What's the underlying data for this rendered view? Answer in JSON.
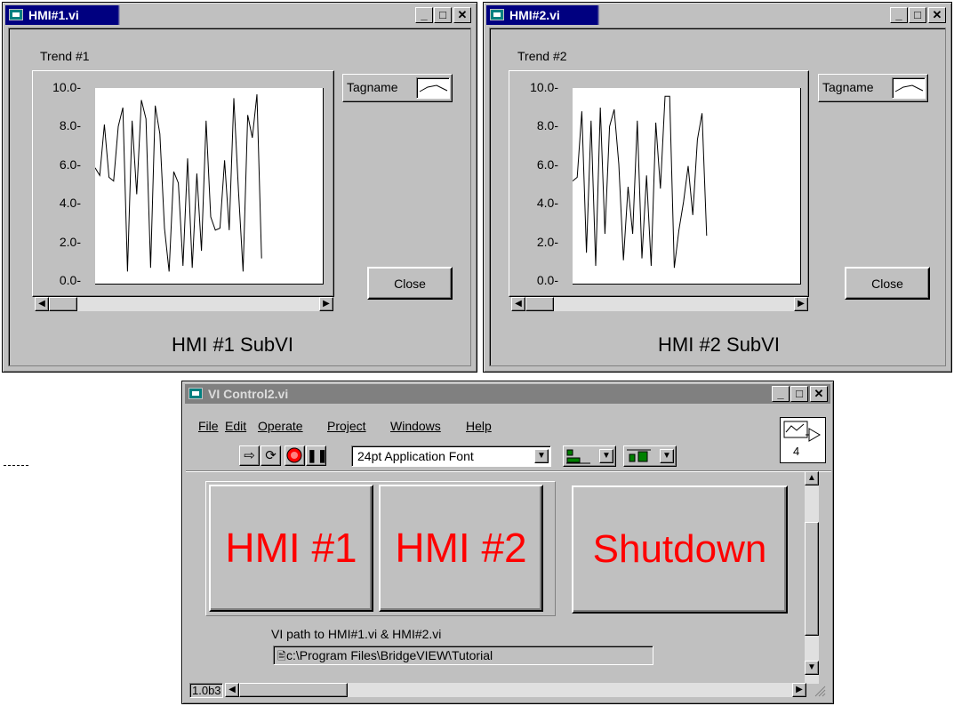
{
  "windows": {
    "hmi1": {
      "title": "HMI#1.vi",
      "trend_label": "Trend #1",
      "legend_label": "Tagname",
      "close_label": "Close",
      "caption": "HMI #1 SubVI"
    },
    "hmi2": {
      "title": "HMI#2.vi",
      "trend_label": "Trend #2",
      "legend_label": "Tagname",
      "close_label": "Close",
      "caption": "HMI #2 SubVI"
    },
    "control": {
      "title": "VI Control2.vi",
      "menu": [
        "File",
        "Edit",
        "Operate",
        "Project",
        "Windows",
        "Help"
      ],
      "font_select": "24pt Application Font",
      "connector_number": "4",
      "buttons": {
        "hmi1": "HMI #1",
        "hmi2": "HMI #2",
        "shutdown": "Shutdown"
      },
      "path_label": "VI path to HMI#1.vi & HMI#2.vi",
      "path_value": "c:\\Program Files\\BridgeVIEW\\Tutorial",
      "version": "1.0b3"
    }
  },
  "titlebar_controls": {
    "minimize": "_",
    "maximize": "□",
    "close": "✕"
  },
  "colors": {
    "titlebar": "#000080",
    "button_text": "#ff0000",
    "face": "#c0c0c0"
  },
  "chart_data": [
    {
      "type": "line",
      "title": "Trend #1",
      "ylim": [
        0,
        10
      ],
      "y_ticks": [
        "10.0-",
        "8.0-",
        "6.0-",
        "4.0-",
        "2.0-",
        "0.0-"
      ],
      "series": [
        {
          "name": "Tagname",
          "values": [
            6.0,
            5.6,
            8.3,
            5.5,
            5.3,
            8.2,
            9.2,
            0.5,
            8.5,
            4.6,
            9.6,
            8.6,
            0.7,
            9.3,
            7.8,
            2.8,
            0.5,
            5.8,
            5.2,
            0.8,
            6.5,
            0.7,
            5.7,
            1.6,
            8.5,
            3.4,
            2.7,
            2.8,
            6.4,
            2.7,
            9.7,
            4.8,
            0.5,
            8.8,
            7.6,
            9.9,
            1.2
          ]
        }
      ]
    },
    {
      "type": "line",
      "title": "Trend #2",
      "ylim": [
        0,
        10
      ],
      "y_ticks": [
        "10.0-",
        "8.0-",
        "6.0-",
        "4.0-",
        "2.0-",
        "0.0-"
      ],
      "series": [
        {
          "name": "Tagname",
          "values": [
            5.3,
            5.5,
            9.0,
            1.5,
            8.5,
            0.8,
            9.2,
            2.5,
            8.2,
            9.1,
            6.2,
            1.1,
            5.0,
            2.5,
            8.5,
            1.2,
            5.6,
            0.8,
            8.4,
            4.9,
            9.8,
            9.8,
            0.7,
            2.7,
            4.2,
            6.1,
            3.5,
            7.5,
            8.9,
            2.4
          ]
        }
      ]
    }
  ]
}
